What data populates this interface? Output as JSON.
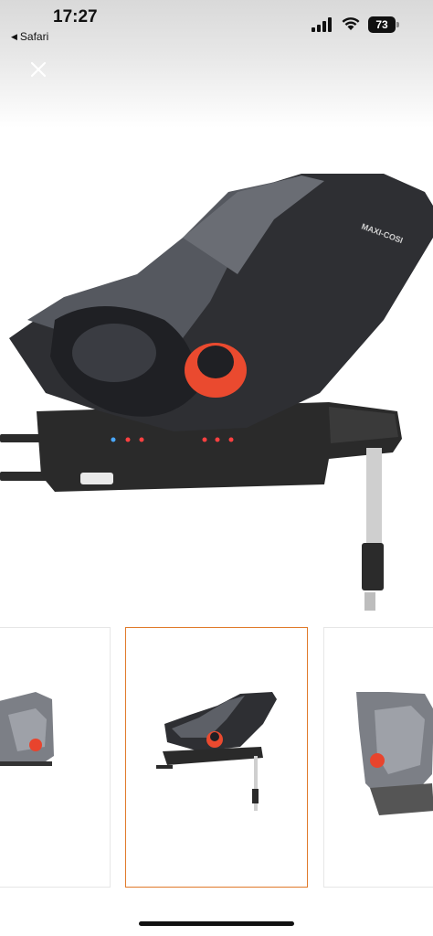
{
  "status_bar": {
    "time": "17:27",
    "back_app": "Safari",
    "battery": "73"
  },
  "viewer": {
    "close_icon": "close-icon",
    "brand_text": "MAXI-COSI",
    "selected_thumbnail_index": 1,
    "accent_color": "#e07a2a"
  },
  "thumbnails": [
    {
      "name": "thumbnail-1"
    },
    {
      "name": "thumbnail-2"
    },
    {
      "name": "thumbnail-3"
    }
  ]
}
